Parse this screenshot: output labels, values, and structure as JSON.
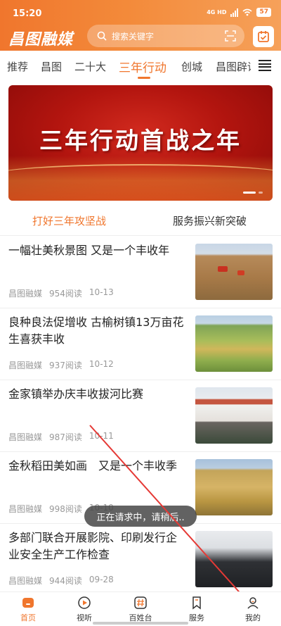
{
  "status": {
    "time": "15:20",
    "network": "4G HD",
    "battery": "57"
  },
  "header": {
    "logo": "昌图融媒",
    "search_placeholder": "搜索关键字"
  },
  "tabs": [
    "推荐",
    "昌图",
    "二十大",
    "三年行动",
    "创城",
    "昌图辟谣"
  ],
  "active_tab": "三年行动",
  "banner": {
    "title": "三年行动首战之年"
  },
  "subtabs": [
    "打好三年攻坚战",
    "服务振兴新突破"
  ],
  "news": [
    {
      "title": "一幅壮美秋景图 又是一个丰收年",
      "source": "昌图融媒",
      "reads": "954阅读",
      "date": "10-13"
    },
    {
      "title": "良种良法促增收 古榆树镇13万亩花生喜获丰收",
      "source": "昌图融媒",
      "reads": "937阅读",
      "date": "10-12"
    },
    {
      "title": "金家镇举办庆丰收拔河比赛",
      "source": "昌图融媒",
      "reads": "987阅读",
      "date": "10-11"
    },
    {
      "title": "金秋稻田美如画　又是一个丰收季",
      "source": "昌图融媒",
      "reads": "998阅读",
      "date": "10-10"
    },
    {
      "title": "多部门联合开展影院、印刷发行企业安全生产工作检查",
      "source": "昌图融媒",
      "reads": "944阅读",
      "date": "09-28"
    }
  ],
  "toast": "正在请求中，请稍后..",
  "bottom_nav": [
    {
      "label": "首页",
      "icon": "home-icon",
      "active": true
    },
    {
      "label": "视听",
      "icon": "play-icon",
      "active": false
    },
    {
      "label": "百姓台",
      "icon": "hashtag-icon",
      "active": false
    },
    {
      "label": "服务",
      "icon": "bookmark-icon",
      "active": false
    },
    {
      "label": "我的",
      "icon": "user-icon",
      "active": false
    }
  ],
  "colors": {
    "accent": "#f0762d",
    "banner_red": "#b3150f",
    "arrow": "#e53935"
  }
}
